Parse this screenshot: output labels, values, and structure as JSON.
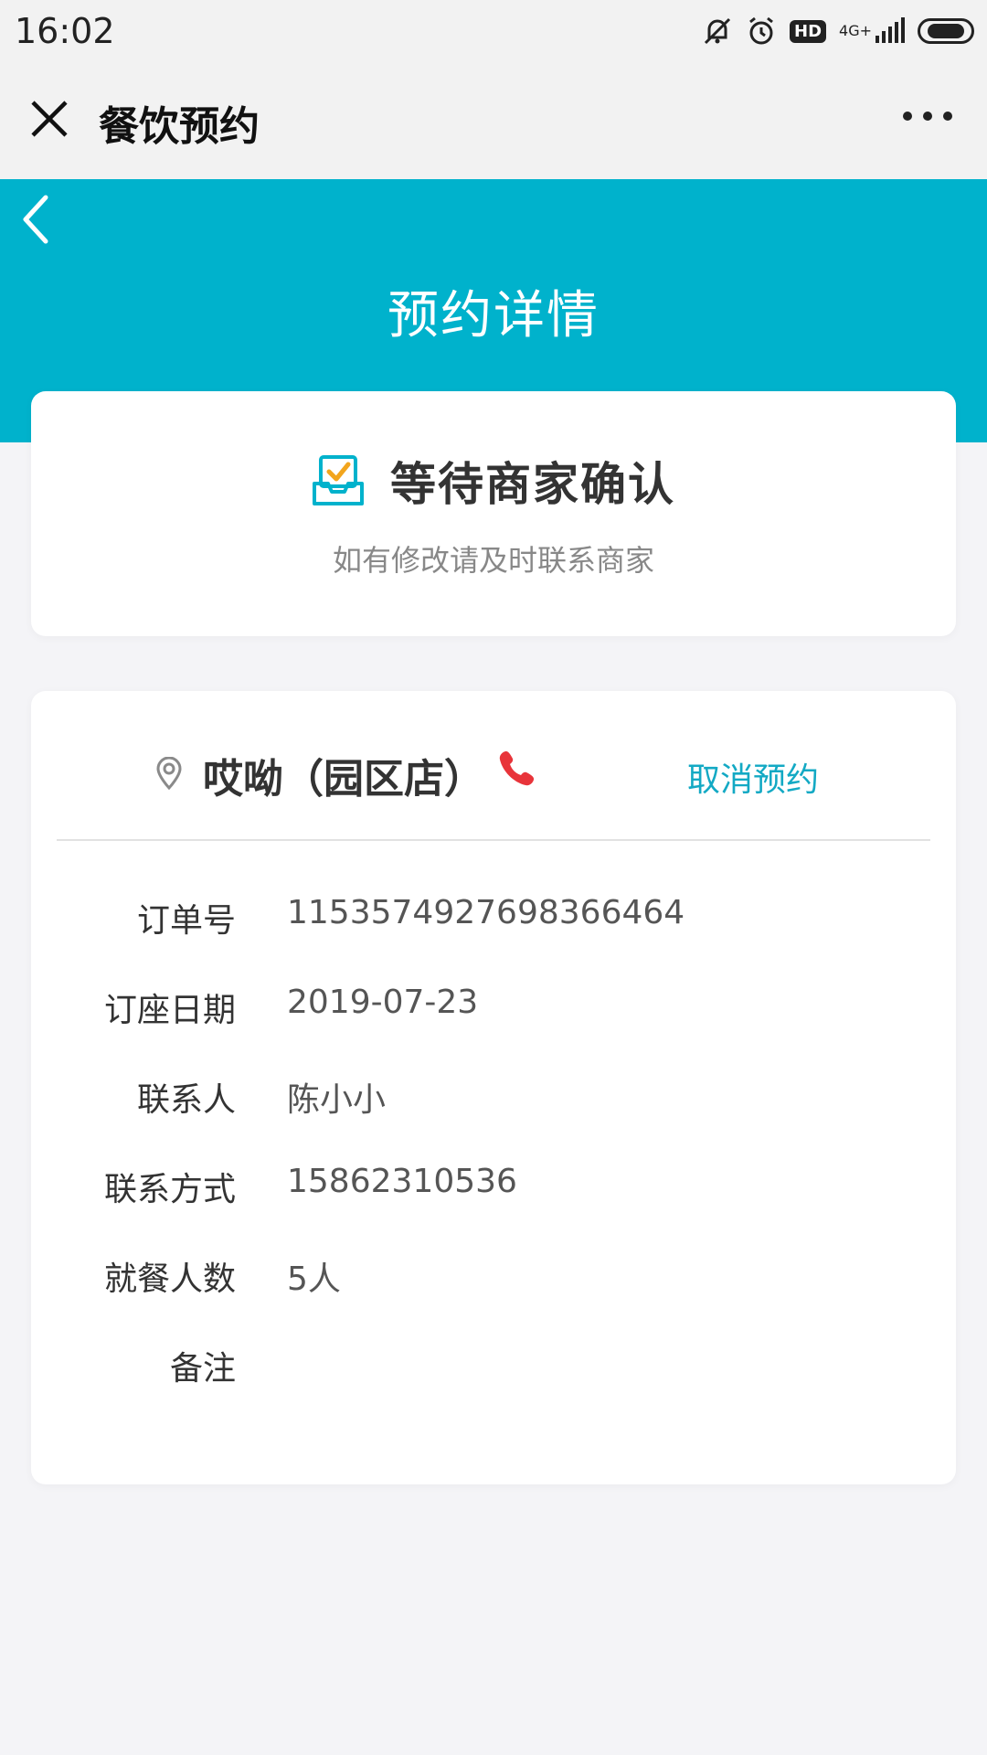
{
  "status_bar": {
    "time": "16:02",
    "hd": "HD",
    "network": "4G+"
  },
  "nav": {
    "title": "餐饮预约"
  },
  "header": {
    "title": "预约详情"
  },
  "status_card": {
    "title": "等待商家确认",
    "subtitle": "如有修改请及时联系商家"
  },
  "store": {
    "name": "哎呦（园区店）",
    "cancel_label": "取消预约"
  },
  "details": [
    {
      "label": "订单号",
      "value": "1153574927698366464"
    },
    {
      "label": "订座日期",
      "value": "2019-07-23"
    },
    {
      "label": "联系人",
      "value": "陈小小"
    },
    {
      "label": "联系方式",
      "value": "15862310536"
    },
    {
      "label": "就餐人数",
      "value": "5人"
    },
    {
      "label": "备注",
      "value": ""
    }
  ],
  "colors": {
    "accent": "#00b2cc",
    "link": "#13a9c4",
    "phone": "#e8343a",
    "check": "#f2a51d"
  }
}
